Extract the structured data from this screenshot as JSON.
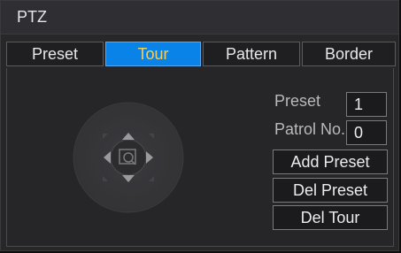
{
  "window": {
    "title": "PTZ"
  },
  "tabs": [
    {
      "label": "Preset",
      "active": false
    },
    {
      "label": "Tour",
      "active": true
    },
    {
      "label": "Pattern",
      "active": false
    },
    {
      "label": "Border",
      "active": false
    }
  ],
  "fields": {
    "preset": {
      "label": "Preset",
      "value": "1"
    },
    "patrol": {
      "label": "Patrol No.",
      "value": "0"
    }
  },
  "buttons": {
    "add_preset": "Add Preset",
    "del_preset": "Del Preset",
    "del_tour": "Del Tour"
  },
  "colors": {
    "active_tab_bg": "#0a83e8",
    "active_tab_text": "#f2d060"
  },
  "icons": {
    "dpad": [
      "arrow-up-icon",
      "arrow-down-icon",
      "arrow-left-icon",
      "arrow-right-icon",
      "zoom-icon"
    ]
  }
}
